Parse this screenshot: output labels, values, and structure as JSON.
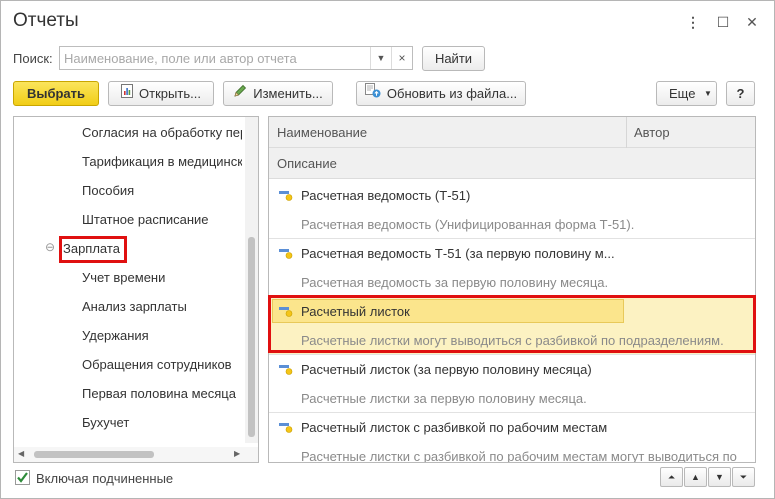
{
  "window": {
    "title": "Отчеты",
    "controls": {
      "menu": "⋮",
      "maximize": "☐",
      "close": "✕"
    }
  },
  "search": {
    "label": "Поиск:",
    "value": "",
    "placeholder": "Наименование, поле или автор отчета",
    "find_button": "Найти"
  },
  "toolbar": {
    "select": "Выбрать",
    "open": "Открыть...",
    "edit": "Изменить...",
    "update_from_file": "Обновить из файла...",
    "more": "Еще",
    "help": "?"
  },
  "tree": {
    "items": [
      {
        "label": "Согласия на обработку персональных данных",
        "level": 1
      },
      {
        "label": "Тарификация в медицинских учреждениях",
        "level": 1
      },
      {
        "label": "Пособия",
        "level": 1
      },
      {
        "label": "Штатное расписание",
        "level": 1
      },
      {
        "label": "Зарплата",
        "level": 0,
        "expanded": true,
        "highlighted": true
      },
      {
        "label": "Учет времени",
        "level": 1
      },
      {
        "label": "Анализ зарплаты",
        "level": 1
      },
      {
        "label": "Удержания",
        "level": 1
      },
      {
        "label": "Обращения сотрудников",
        "level": 1
      },
      {
        "label": "Первая половина месяца",
        "level": 1
      },
      {
        "label": "Бухучет",
        "level": 1
      }
    ],
    "collapse_glyph": "⊖"
  },
  "grid": {
    "columns": {
      "name": "Наименование",
      "author": "Автор",
      "description": "Описание"
    },
    "rows": [
      {
        "title": "Расчетная ведомость (Т-51)",
        "description": "Расчетная ведомость (Унифицированная форма Т-51).",
        "selected": false
      },
      {
        "title": "Расчетная ведомость Т-51 (за первую половину м...",
        "description": "Расчетная ведомость за первую половину месяца.",
        "selected": false
      },
      {
        "title": "Расчетный листок",
        "description": "Расчетные листки могут выводиться с разбивкой по подразделениям.",
        "selected": true
      },
      {
        "title": "Расчетный листок (за первую половину месяца)",
        "description": "Расчетные листки за первую половину месяца.",
        "selected": false
      },
      {
        "title": "Расчетный листок с разбивкой по рабочим местам",
        "description": "Расчетные листки с разбивкой по рабочим местам могут выводиться по",
        "selected": false
      }
    ]
  },
  "footer": {
    "include_subordinate": {
      "label": "Включая подчиненные",
      "checked": true
    },
    "nav": {
      "first": "⏶",
      "up": "▲",
      "down": "▼",
      "last": "⏷"
    }
  },
  "colors": {
    "primary_button": "#f5d625",
    "selection_row": "#fcf2c2",
    "selection_cell": "#fbe58c",
    "highlight_border": "#e01010"
  }
}
